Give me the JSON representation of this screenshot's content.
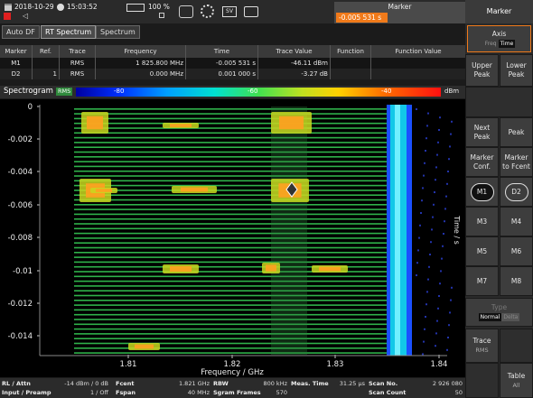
{
  "topbar": {
    "date": "2018-10-29",
    "time": "15:03:52",
    "battery": "100 %",
    "marker_label": "Marker",
    "marker_value": "-0.005 531 s",
    "sv_icon_label": "SV"
  },
  "tabs": [
    {
      "label": "Auto DF",
      "active": false
    },
    {
      "label": "RT Spectrum",
      "active": true
    },
    {
      "label": "Spectrum",
      "active": false
    }
  ],
  "marker_table": {
    "headers": [
      "Marker",
      "Ref.",
      "Trace",
      "Frequency",
      "Time",
      "Trace Value",
      "Function",
      "Function Value"
    ],
    "rows": [
      [
        "M1",
        "",
        "RMS",
        "1 825.800 MHz",
        "-0.005 531 s",
        "-46.11 dBm",
        "",
        ""
      ],
      [
        "D2",
        "1",
        "RMS",
        "0.000 MHz",
        "0.001 000 s",
        "-3.27 dB",
        "",
        ""
      ]
    ]
  },
  "spectrogram": {
    "title": "Spectrogram",
    "trace_badge": "RMS",
    "colorbar_labels": [
      "-80",
      "-60",
      "-40"
    ],
    "colorbar_unit": "dBm",
    "y_ticks": [
      "0",
      "-0.002",
      "-0.004",
      "-0.006",
      "-0.008",
      "-0.01",
      "-0.012",
      "-0.014"
    ],
    "x_ticks": [
      "1.81",
      "1.82",
      "1.83",
      "1.84"
    ],
    "x_label": "Frequency / GHz",
    "y_label": "Time / s",
    "markers": [
      "M1"
    ]
  },
  "bottom": {
    "rl_label": "RL / Attn",
    "rl_value": "-14 dBm / 0 dB",
    "inp_label": "Input / Preamp",
    "inp_value": "1 / Off",
    "fcent_label": "Fcent",
    "fcent_value": "1.821 GHz",
    "fspan_label": "Fspan",
    "fspan_value": "40 MHz",
    "rbw_label": "RBW",
    "rbw_value": "800 kHz",
    "sgram_label": "Sgram Frames",
    "sgram_value": "570",
    "meas_label": "Meas. Time",
    "meas_value": "31.25 µs",
    "scanno_label": "Scan No.",
    "scanno_value": "2 926 080",
    "scancount_label": "Scan Count",
    "scancount_value": "50"
  },
  "panel": {
    "title": "Marker",
    "axis_label": "Axis",
    "axis_opts": [
      "Freq",
      "Time"
    ],
    "upper_peak": "Upper Peak",
    "lower_peak": "Lower Peak",
    "next_peak": "Next Peak",
    "peak": "Peak",
    "marker_conf": "Marker Conf.",
    "marker_to_fcent": "Marker to Fcent",
    "m1": "M1",
    "d2": "D2",
    "m3": "M3",
    "m4": "M4",
    "m5": "M5",
    "m6": "M6",
    "m7": "M7",
    "m8": "M8",
    "type_label": "Type",
    "type_opts": [
      "Normal",
      "Delta"
    ],
    "trace_label": "Trace",
    "trace_value": "RMS",
    "table_label": "Table",
    "table_value": "All"
  },
  "colors": {
    "accent_orange": "#f07a1a",
    "rms_green": "#2f8a3c"
  }
}
